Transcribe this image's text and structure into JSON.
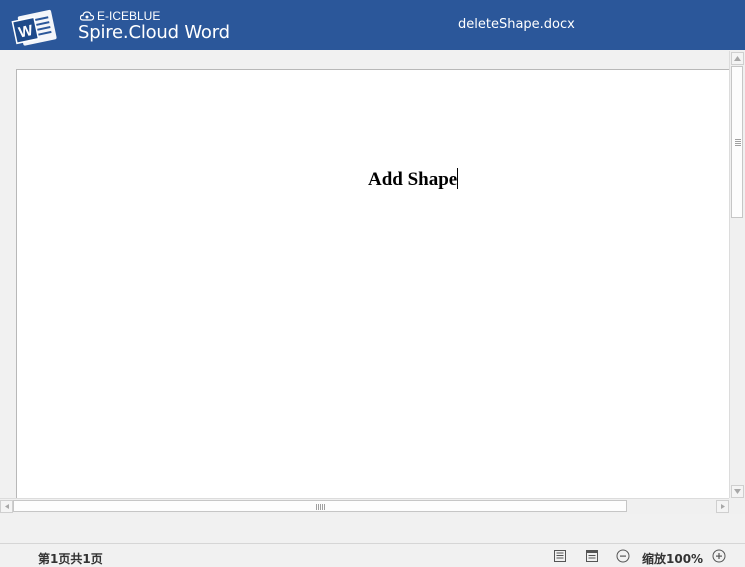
{
  "header": {
    "brand_small": "E-ICEBLUE",
    "brand_big": "Spire.Cloud Word",
    "document_name": "deleteShape.docx",
    "background_color": "#2b579a"
  },
  "document": {
    "text": "Add Shape"
  },
  "statusbar": {
    "page_info": "第1页共1页",
    "zoom_label": "缩放100%",
    "icons": [
      "print-layout-icon",
      "web-layout-icon",
      "zoom-out-icon",
      "zoom-in-icon"
    ]
  }
}
